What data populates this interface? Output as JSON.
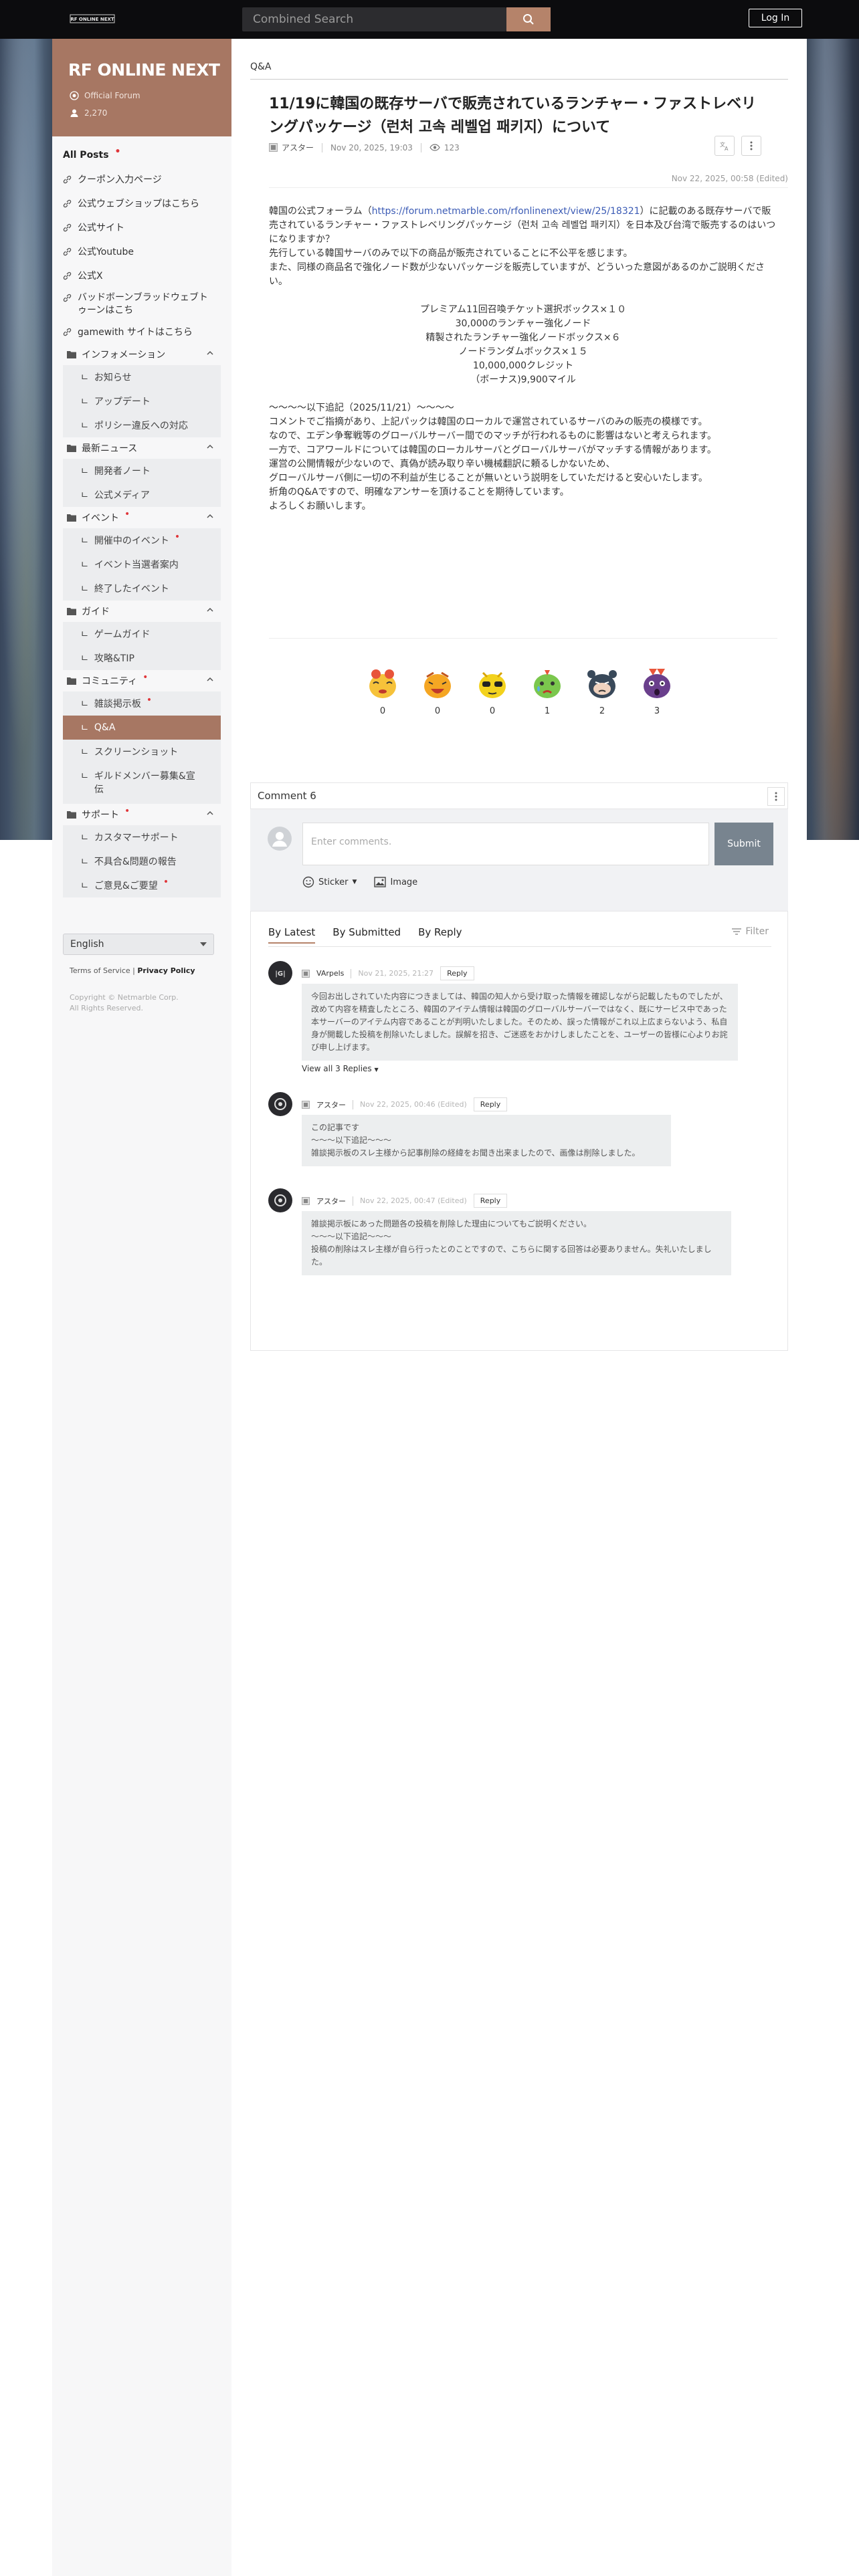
{
  "header": {
    "logo_text": "RF ONLINE NEXT",
    "search_placeholder": "Combined Search",
    "login_label": "Log In"
  },
  "sidebar": {
    "forum_title": "RF ONLINE NEXT",
    "official_label": "Official Forum",
    "member_count": "2,270",
    "all_posts": "All Posts",
    "links": [
      {
        "label": "クーポン入力ページ"
      },
      {
        "label": "公式ウェブショップはこちら"
      },
      {
        "label": "公式サイト"
      },
      {
        "label": "公式Youtube"
      },
      {
        "label": "公式X"
      },
      {
        "label": "バッドボーンブラッドウェブトゥーンはこち"
      },
      {
        "label": "gamewith サイトはこちら"
      }
    ],
    "categories": [
      {
        "label": "インフォメーション",
        "subs": [
          "お知らせ",
          "アップデート",
          "ポリシー違反への対応"
        ]
      },
      {
        "label": "最新ニュース",
        "subs": [
          "開発者ノート",
          "公式メディア"
        ]
      },
      {
        "label": "イベント",
        "subs": [
          "開催中のイベント",
          "イベント当選者案内",
          "終了したイベント"
        ]
      },
      {
        "label": "ガイド",
        "subs": [
          "ゲームガイド",
          "攻略&TIP"
        ]
      },
      {
        "label": "コミュニティ",
        "subs": [
          "雑談掲示板",
          "Q&A",
          "スクリーンショット",
          "ギルドメンバー募集&宣伝"
        ]
      },
      {
        "label": "サポート",
        "subs": [
          "カスタマーサポート",
          "不具合&問題の報告",
          "ご意見&ご要望"
        ]
      }
    ],
    "language": "English",
    "terms": "Terms of Service",
    "privacy": "Privacy Policy",
    "copyright_1": "Copyright © Netmarble Corp.",
    "copyright_2": "All Rights Reserved."
  },
  "post": {
    "breadcrumb": "Q&A",
    "title": "11/19に韓国の既存サーバで販売されているランチャー・ファストレベリングパッケージ（런처 고속 레벨업 패키지）について",
    "author": "アスター",
    "date": "Nov 20, 2025, 19:03",
    "views": "123",
    "edited": "Nov 22, 2025, 00:58 (Edited)",
    "p1_pre": "韓国の公式フォーラム（",
    "p1_link": "https://forum.netmarble.com/rfonlinenext/view/25/18321",
    "p1_post": "）に記載のある既存サーバで販売されているランチャー・ファストレベリングパッケージ（런처 고속 레벨업 패키지）を日本及び台湾で販売するのはいつになりますか？",
    "p2": "先行している韓国サーバのみで以下の商品が販売されていることに不公平を感じます。",
    "p3": "また、同様の商品名で強化ノード数が少ないパッケージを販売していますが、どういった意図があるのかご説明ください。",
    "items": [
      "プレミアム11回召喚チケット選択ボックス×１０",
      "30,000のランチャー強化ノード",
      "精製されたランチャー強化ノードボックス×６",
      "ノードランダムボックス×１５",
      "10,000,000クレジット",
      "（ボーナス)9,900マイル"
    ],
    "addendum": [
      "～～～～以下追記（2025/11/21）～～～～",
      "コメントでご指摘があり、上記パックは韓国のローカルで運営されているサーバのみの販売の模様です。",
      "なので、エデン争奪戦等のグローバルサーバー間でのマッチが行われるものに影響はないと考えられます。",
      "一方で、コアワールドについては韓国のローカルサーバとグローバルサーバがマッチする情報があります。",
      "運営の公開情報が少ないので、真偽が読み取り辛い機械翻訳に頼るしかないため、",
      "グローバルサーバ側に一切の不利益が生じることが無いという説明をしていただけると安心いたします。",
      "折角のQ&Aですので、明確なアンサーを頂けることを期待しています。",
      "よろしくお願いします。"
    ],
    "reactions": [
      {
        "name": "love-reaction",
        "count": "0",
        "color": "#f6c23a"
      },
      {
        "name": "laugh-reaction",
        "count": "0",
        "color": "#f5a623"
      },
      {
        "name": "cool-reaction",
        "count": "0",
        "color": "#f3d21d"
      },
      {
        "name": "sad-reaction",
        "count": "1",
        "color": "#7bc74d"
      },
      {
        "name": "angry-reaction",
        "count": "2",
        "color": "#39495a"
      },
      {
        "name": "shock-reaction",
        "count": "3",
        "color": "#6a3f8c"
      }
    ]
  },
  "comments": {
    "header": "Comment 6",
    "input_placeholder": "Enter comments.",
    "submit_label": "Submit",
    "sticker_label": "Sticker",
    "image_label": "Image",
    "sort_tabs": [
      "By Latest",
      "By Submitted",
      "By Reply"
    ],
    "filter_label": "Filter",
    "reply_label": "Reply",
    "view_replies": "View all 3 Replies",
    "items": [
      {
        "author": "VArpels",
        "date": "Nov 21, 2025, 21:27",
        "text": "今回お出しされていた内容につきましては、韓国の知人から受け取った情報を確認しながら記載したものでしたが、改めて内容を精査したところ、韓国のアイテム情報は韓国のグローバルサーバーではなく、既にサービス中であった本サーバーのアイテム内容であることが判明いたしました。そのため、誤った情報がこれ以上広まらないよう、私自身が開載した投稿を削除いたしました。誤解を招き、ご迷惑をおかけしましたことを、ユーザーの皆様に心よりお詫び申し上げます。"
      },
      {
        "author": "アスター",
        "date": "Nov 22, 2025, 00:46 (Edited)",
        "line1": "この記事です",
        "line2": "～～～以下追記～～～",
        "line3": "雑談掲示板のスレ主様から記事削除の経緯をお聞き出来ましたので、画像は削除しました。"
      },
      {
        "author": "アスター",
        "date": "Nov 22, 2025, 00:47 (Edited)",
        "line1": "雑談掲示板にあった問題各の投稿を削除した理由についてもご説明ください。",
        "line2": "～～～以下追記～～～",
        "line3": "投稿の削除はスレ主様が自ら行ったとのことですので、こちらに関する回答は必要ありません。失礼いたしました。"
      }
    ]
  }
}
